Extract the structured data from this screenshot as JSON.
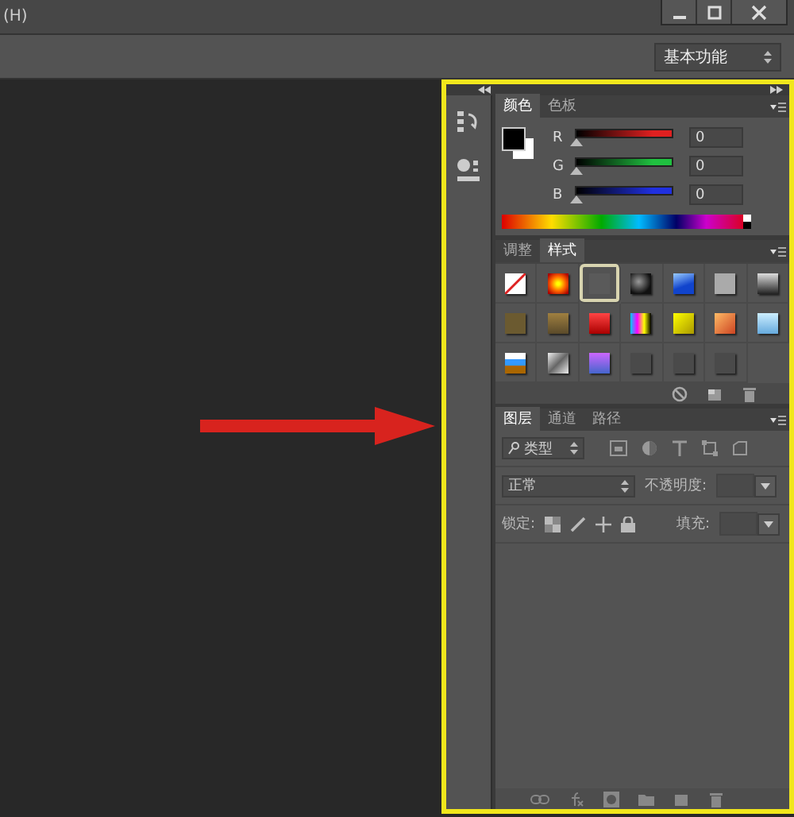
{
  "menu_bar": {
    "last_item": "(H)"
  },
  "workspace": {
    "value": "基本功能"
  },
  "color_panel": {
    "tabs": [
      {
        "label": "颜色",
        "selected": true
      },
      {
        "label": "色板",
        "selected": false
      }
    ],
    "channels": [
      {
        "name": "R",
        "value": "0",
        "level": 0,
        "color": "#e02020"
      },
      {
        "name": "G",
        "value": "0",
        "level": 0,
        "color": "#20c040"
      },
      {
        "name": "B",
        "value": "0",
        "level": 0,
        "color": "#2030e0"
      }
    ]
  },
  "styles_panel": {
    "tabs": [
      {
        "label": "调整",
        "selected": false
      },
      {
        "label": "样式",
        "selected": true
      }
    ],
    "swatches": [
      {
        "selected": false
      },
      {
        "selected": false
      },
      {
        "selected": true
      },
      {
        "selected": false
      },
      {
        "selected": false
      },
      {
        "selected": false
      },
      {
        "selected": false
      },
      {
        "selected": false
      },
      {
        "selected": false
      },
      {
        "selected": false
      },
      {
        "selected": false
      },
      {
        "selected": false
      },
      {
        "selected": false
      },
      {
        "selected": false
      },
      {
        "selected": false
      },
      {
        "selected": false
      },
      {
        "selected": false
      },
      {
        "selected": false
      },
      {
        "selected": false
      },
      {
        "selected": false
      }
    ]
  },
  "layers_panel": {
    "tabs": [
      {
        "label": "图层",
        "selected": true
      },
      {
        "label": "通道",
        "selected": false
      },
      {
        "label": "路径",
        "selected": false
      }
    ],
    "filter": "类型",
    "blend_mode": "正常",
    "opacity_label": "不透明度:",
    "lock_label": "锁定:",
    "fill_label": "填充:"
  }
}
